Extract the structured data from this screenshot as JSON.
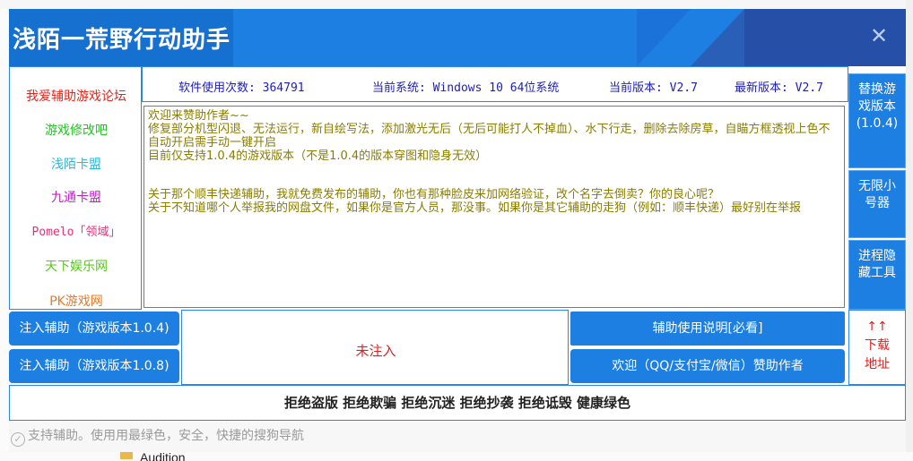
{
  "app": {
    "title": "浅陌一荒野行动助手"
  },
  "links": [
    {
      "label": "我爱辅助游戏论坛",
      "color": "#e0261d"
    },
    {
      "label": "游戏修改吧",
      "color": "#28c028"
    },
    {
      "label": "浅陌卡盟",
      "color": "#2bb8d8"
    },
    {
      "label": "九通卡盟",
      "color": "#c020c8"
    },
    {
      "label": "Pomelo「领域」",
      "color": "#e8307a"
    },
    {
      "label": "天下娱乐网",
      "color": "#58c81c"
    },
    {
      "label": "PK游戏网",
      "color": "#f07820"
    }
  ],
  "info": {
    "usage": "软件使用次数: 364791",
    "system": "当前系统: Windows 10  64位系统",
    "current_version": "当前版本: V2.7",
    "latest_version": "最新版本: V2.7"
  },
  "message": {
    "lines_a": [
      "欢迎来赞助作者~~",
      "修复部分机型闪退、无法运行，新自绘写法，添加激光无后（无后可能打人不掉血）、水下行走，删除去除房草，自瞄方框透视上色不自动开启需手动一键开启",
      "目前仅支持1.0.4的游戏版本（不是1.0.4的版本穿图和隐身无效）"
    ],
    "lines_b": [
      "关于那个顺丰快递辅助，我就免费发布的辅助，你也有那种脸皮来加网络验证，改个名字去倒卖？你的良心呢？",
      "关于不知道哪个人举报我的网盘文件，如果你是官方人员，那没事。如果你是其它辅助的走狗（例如：顺丰快递）最好别在举报"
    ]
  },
  "right_buttons": {
    "replace_version": "替换游戏版本(1.0.4)",
    "unlimited_accounts": "无限小号器",
    "process_hide": "进程隐藏工具"
  },
  "buttons": {
    "inject_104": "注入辅助（游戏版本1.0.4)",
    "inject_108": "注入辅助（游戏版本1.0.8)",
    "guide": "辅助使用说明[必看]",
    "sponsor": "欢迎（QQ/支付宝/微信）赞助作者",
    "download_arrow": "↑↑",
    "download": "下载地址"
  },
  "status": {
    "inject_state": "未注入"
  },
  "slogan": "拒绝盗版 拒绝欺骗 拒绝沉迷 拒绝抄袭 拒绝诋毁 健康绿色",
  "footer": {
    "text": "支持辅助。使用用最绿色，安全，快捷的搜狗导航"
  },
  "background": {
    "folder_label": "Audition"
  }
}
